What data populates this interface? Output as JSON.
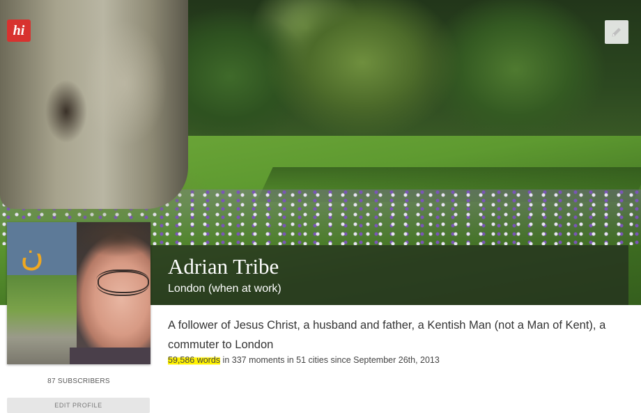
{
  "header": {
    "logo_text": "hi",
    "logo_color": "#d8322f"
  },
  "cover": {
    "edit_icon": "pencil-icon"
  },
  "profile": {
    "name": "Adrian Tribe",
    "location": "London (when at work)",
    "bio": "A follower of Jesus Christ, a husband and father, a Kentish Man (not a Man of Kent), a commuter to London",
    "stats": {
      "words": "59,586 words",
      "rest": " in 337 moments in 51 cities since September 26th, 2013",
      "highlight_color": "#fff200"
    },
    "avatar_badge": "ن",
    "avatar_badge_color": "#f0a820",
    "subscribers": "87 SUBSCRIBERS",
    "edit_profile_label": "EDIT PROFILE"
  }
}
